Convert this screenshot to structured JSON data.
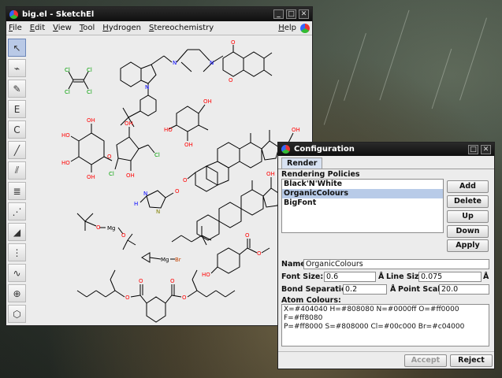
{
  "main_window": {
    "title": "big.el - SketchEl",
    "menus": [
      "File",
      "Edit",
      "View",
      "Tool",
      "Hydrogen",
      "Stereochemistry"
    ],
    "help": "Help"
  },
  "tools": [
    {
      "name": "select-tool-icon",
      "glyph": "↖",
      "active": true
    },
    {
      "name": "lasso-tool-icon",
      "glyph": "⌁",
      "active": false
    },
    {
      "name": "eraser-tool-icon",
      "glyph": "✎",
      "active": false
    },
    {
      "name": "element-tool-icon",
      "glyph": "E",
      "active": false
    },
    {
      "name": "charge-tool-icon",
      "glyph": "C",
      "active": false
    },
    {
      "name": "single-bond-icon",
      "glyph": "╱",
      "active": false
    },
    {
      "name": "double-bond-icon",
      "glyph": "⫽",
      "active": false
    },
    {
      "name": "triple-bond-icon",
      "glyph": "≣",
      "active": false
    },
    {
      "name": "zero-bond-icon",
      "glyph": "⋰",
      "active": false
    },
    {
      "name": "wedge-bond-icon",
      "glyph": "◢",
      "active": false
    },
    {
      "name": "hash-bond-icon",
      "glyph": "⋮",
      "active": false
    },
    {
      "name": "chain-tool-icon",
      "glyph": "∿",
      "active": false
    },
    {
      "name": "zoom-charge-icon",
      "glyph": "⊕",
      "active": false
    },
    {
      "name": "ring-template-icon",
      "glyph": "⬡",
      "active": false
    }
  ],
  "molecule_labels": {
    "cl": "Cl",
    "o": "O",
    "n": "N",
    "oh": "OH",
    "ho": "HO",
    "mg": "Mg",
    "br": "Br",
    "h": "H"
  },
  "config_window": {
    "title": "Configuration",
    "tab": "Render",
    "policies_label": "Rendering Policies",
    "policies": [
      "Black'N'White",
      "OrganicColours",
      "BigFont"
    ],
    "selected_policy": 1,
    "buttons": {
      "add": "Add",
      "delete": "Delete",
      "up": "Up",
      "down": "Down",
      "apply": "Apply"
    },
    "name_label": "Name:",
    "name_value": "OrganicColours",
    "font_size_label": "Font Size:",
    "font_size_value": "0.6",
    "font_size_unit": "Å",
    "line_size_label": "Line Size:",
    "line_size_value": "0.075",
    "line_size_unit": "Å",
    "bond_sep_label": "Bond Separation:",
    "bond_sep_value": "0.2",
    "point_scale_unit": "Å",
    "point_scale_label": "Point Scale:",
    "point_scale_value": "20.0",
    "atom_colours_label": "Atom Colours:",
    "atom_colours_line1": "X=#404040 H=#808080 N=#0000ff O=#ff0000 F=#ff8080",
    "atom_colours_line2": "P=#ff8000 S=#808000 Cl=#00c000 Br=#c04000",
    "accept": "Accept",
    "reject": "Reject"
  }
}
